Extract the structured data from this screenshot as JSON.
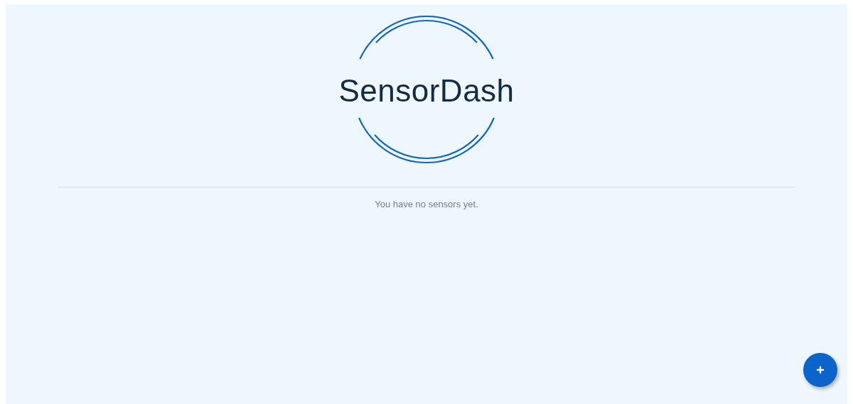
{
  "logo": {
    "text": "SensorDash"
  },
  "empty_message": "You have no sensors yet.",
  "add_button": {
    "kind": "fab"
  }
}
